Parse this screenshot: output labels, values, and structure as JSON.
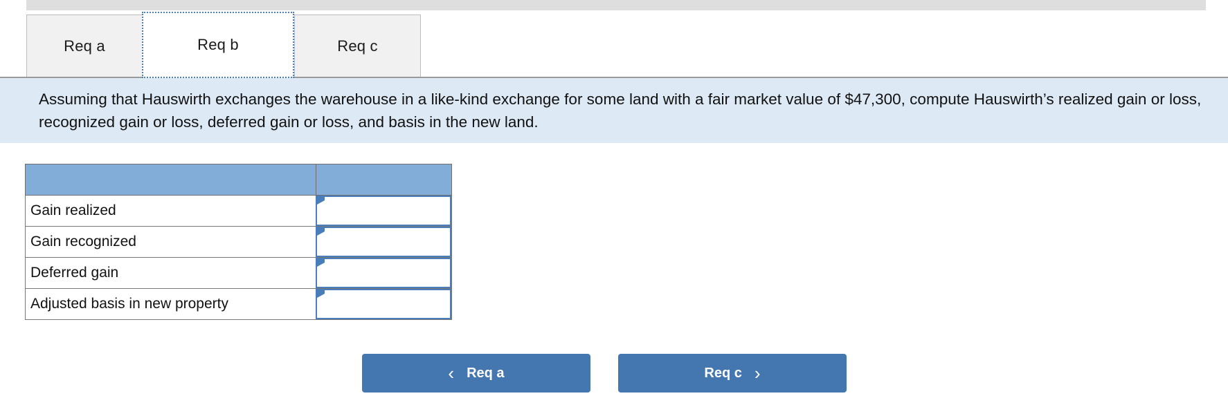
{
  "top_strip": {
    "present": true,
    "color": "#dedede"
  },
  "tabs": {
    "items": [
      {
        "id": "req-a",
        "label": "Req a",
        "active": false
      },
      {
        "id": "req-b",
        "label": "Req b",
        "active": true
      },
      {
        "id": "req-c",
        "label": "Req c",
        "active": false
      }
    ]
  },
  "instruction": {
    "text": "Assuming that Hauswirth exchanges the warehouse in a like-kind exchange for some land with a fair market value of $47,300, compute Hauswirth’s realized gain or loss, recognized gain or loss, deferred gain or loss, and basis in the new land.",
    "background": "#ddeaf6"
  },
  "table": {
    "header": {
      "col1": "",
      "col2": "",
      "fill": "#83add9"
    },
    "rows": [
      {
        "label": "Gain realized",
        "value": "",
        "placeholder": ""
      },
      {
        "label": "Gain recognized",
        "value": "",
        "placeholder": ""
      },
      {
        "label": "Deferred gain",
        "value": "",
        "placeholder": ""
      },
      {
        "label": "Adjusted basis in new property",
        "value": "",
        "placeholder": ""
      }
    ]
  },
  "navigation": {
    "prev": {
      "label": "Req a",
      "icon": "chevron-left-icon",
      "glyph": "‹"
    },
    "next": {
      "label": "Req c",
      "icon": "chevron-right-icon",
      "glyph": "›"
    },
    "color": "#4476b0"
  }
}
